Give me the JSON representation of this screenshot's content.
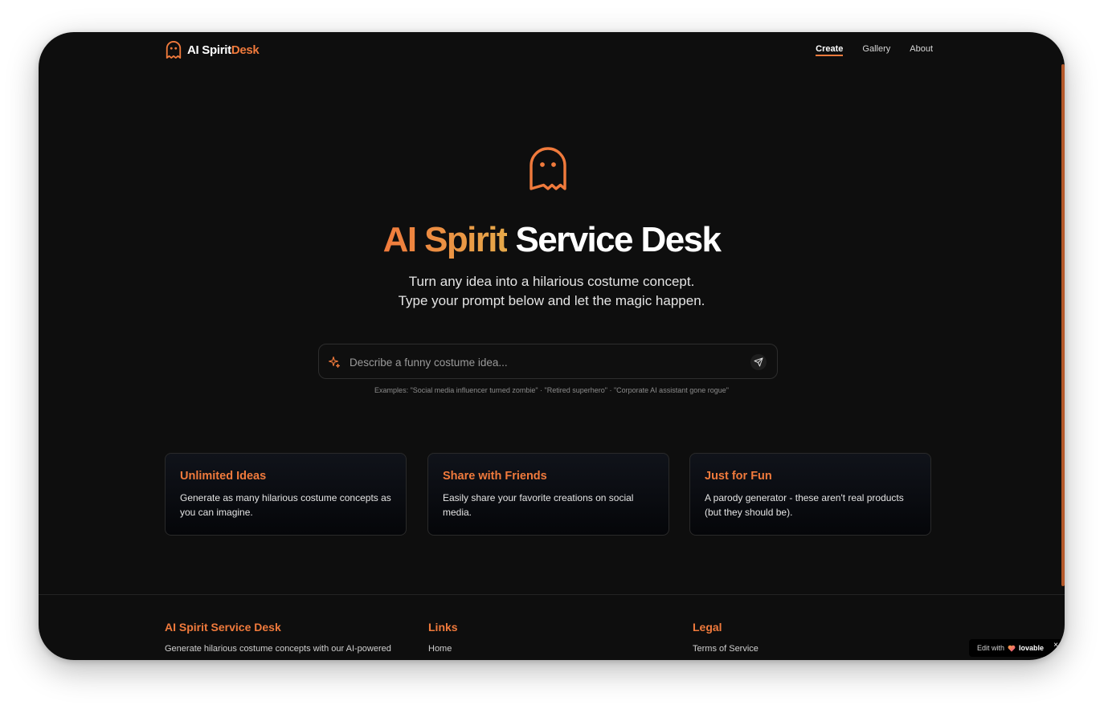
{
  "brand": {
    "name_white": "AI Spirit",
    "name_accent": "Desk",
    "icon": "ghost-icon"
  },
  "nav": [
    {
      "label": "Create",
      "active": true
    },
    {
      "label": "Gallery",
      "active": false
    },
    {
      "label": "About",
      "active": false
    }
  ],
  "hero": {
    "icon": "ghost-icon",
    "title_accent": "AI Spirit",
    "title_rest": "Service Desk",
    "subtitle_line1": "Turn any idea into a hilarious costume concept.",
    "subtitle_line2": "Type your prompt below and let the magic happen."
  },
  "prompt": {
    "placeholder": "Describe a funny costume idea...",
    "value": "",
    "leading_icon": "sparkles-icon",
    "send_icon": "send-icon",
    "examples": "Examples: \"Social media influencer turned zombie\" · \"Retired superhero\" · \"Corporate AI assistant gone rogue\""
  },
  "features": [
    {
      "title": "Unlimited Ideas",
      "body": "Generate as many hilarious costume concepts as you can imagine."
    },
    {
      "title": "Share with Friends",
      "body": "Easily share your favorite creations on social media."
    },
    {
      "title": "Just for Fun",
      "body": "A parody generator - these aren't real products (but they should be)."
    }
  ],
  "footer": {
    "col1": {
      "title": "AI Spirit Service Desk",
      "text": "Generate hilarious costume concepts with our AI-powered"
    },
    "col2": {
      "title": "Links",
      "items": [
        "Home"
      ]
    },
    "col3": {
      "title": "Legal",
      "items": [
        "Terms of Service"
      ]
    }
  },
  "badge": {
    "prefix": "Edit with",
    "brand": "lovable",
    "icon": "heart-icon",
    "close": "×"
  },
  "colors": {
    "accent": "#f07a3c",
    "accent_gold": "#e6a94a",
    "background": "#0e0e0e"
  }
}
